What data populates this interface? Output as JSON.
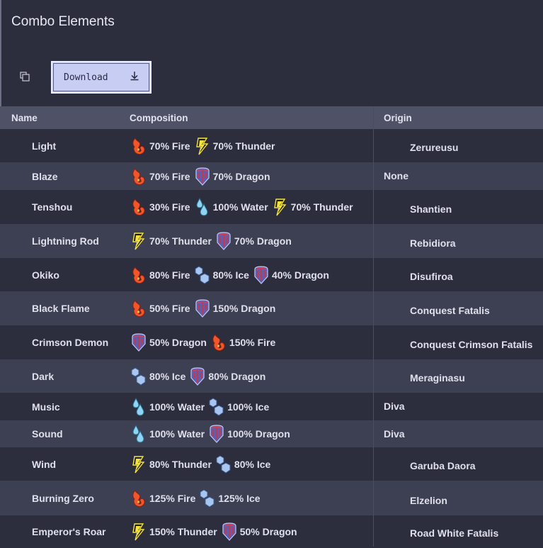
{
  "title": "Combo Elements",
  "toolbar": {
    "download_label": "Download"
  },
  "columns": {
    "name": "Name",
    "composition": "Composition",
    "origin": "Origin"
  },
  "rows": [
    {
      "name": "Light",
      "composition": [
        {
          "element": "fire",
          "label": "70% Fire"
        },
        {
          "element": "thunder",
          "label": "70% Thunder"
        }
      ],
      "origin": "Zerureusu"
    },
    {
      "name": "Blaze",
      "composition": [
        {
          "element": "fire",
          "label": "70% Fire"
        },
        {
          "element": "dragon",
          "label": "70% Dragon"
        }
      ],
      "origin": "None"
    },
    {
      "name": "Tenshou",
      "composition": [
        {
          "element": "fire",
          "label": "30% Fire"
        },
        {
          "element": "water",
          "label": "100% Water"
        },
        {
          "element": "thunder",
          "label": "70% Thunder"
        }
      ],
      "origin": "Shantien"
    },
    {
      "name": "Lightning Rod",
      "composition": [
        {
          "element": "thunder",
          "label": "70% Thunder"
        },
        {
          "element": "dragon",
          "label": "70% Dragon"
        }
      ],
      "origin": "Rebidiora"
    },
    {
      "name": "Okiko",
      "composition": [
        {
          "element": "fire",
          "label": "80% Fire"
        },
        {
          "element": "ice",
          "label": "80% Ice"
        },
        {
          "element": "dragon",
          "label": "40% Dragon"
        }
      ],
      "origin": "Disufiroa"
    },
    {
      "name": "Black Flame",
      "composition": [
        {
          "element": "fire",
          "label": "50% Fire"
        },
        {
          "element": "dragon",
          "label": "150% Dragon"
        }
      ],
      "origin": "Conquest Fatalis"
    },
    {
      "name": "Crimson Demon",
      "composition": [
        {
          "element": "dragon",
          "label": "50% Dragon"
        },
        {
          "element": "fire",
          "label": "150% Fire"
        }
      ],
      "origin": "Conquest Crimson Fatalis"
    },
    {
      "name": "Dark",
      "composition": [
        {
          "element": "ice",
          "label": "80% Ice"
        },
        {
          "element": "dragon",
          "label": "80% Dragon"
        }
      ],
      "origin": "Meraginasu"
    },
    {
      "name": "Music",
      "composition": [
        {
          "element": "water",
          "label": "100% Water"
        },
        {
          "element": "ice",
          "label": "100% Ice"
        }
      ],
      "origin": "Diva"
    },
    {
      "name": "Sound",
      "composition": [
        {
          "element": "water",
          "label": "100% Water"
        },
        {
          "element": "dragon",
          "label": "100% Dragon"
        }
      ],
      "origin": "Diva"
    },
    {
      "name": "Wind",
      "composition": [
        {
          "element": "thunder",
          "label": "80% Thunder"
        },
        {
          "element": "ice",
          "label": "80% Ice"
        }
      ],
      "origin": "Garuba Daora"
    },
    {
      "name": "Burning Zero",
      "composition": [
        {
          "element": "fire",
          "label": "125% Fire"
        },
        {
          "element": "ice",
          "label": "125% Ice"
        }
      ],
      "origin": "Elzelion"
    },
    {
      "name": "Emperor's Roar",
      "composition": [
        {
          "element": "thunder",
          "label": "150% Thunder"
        },
        {
          "element": "dragon",
          "label": "50% Dragon"
        }
      ],
      "origin": "Road White Fatalis"
    }
  ],
  "icons": {
    "copy": "copy-icon",
    "download": "download-icon",
    "fire": "fire-icon",
    "thunder": "thunder-icon",
    "water": "water-icon",
    "ice": "ice-icon",
    "dragon": "dragon-icon"
  },
  "colors": {
    "background": "#2c2d3d",
    "row_alt": "#3d3f52",
    "header": "#4f5166",
    "download_button": "#c8cdf4",
    "fire": "#f0562a",
    "thunder": "#f5e33a",
    "water": "#8fd4f2",
    "ice": "#a8c6ef",
    "dragon": "#9b3a55"
  }
}
